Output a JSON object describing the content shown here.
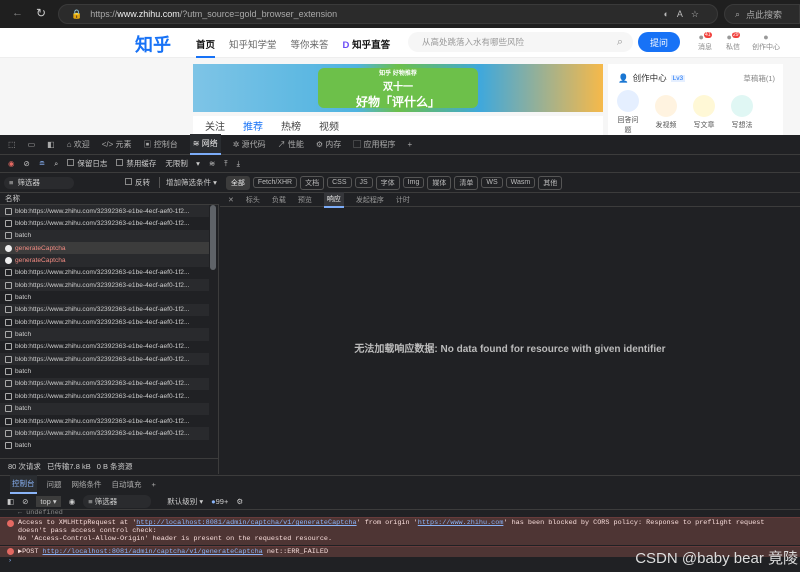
{
  "browser": {
    "url_prefix": "https://",
    "url_host": "www.zhihu.com",
    "url_rest": "/?utm_source=gold_browser_extension",
    "search_placeholder": "点此搜索"
  },
  "zhihu": {
    "logo": "知乎",
    "nav": [
      "首页",
      "知乎知学堂",
      "等你来答",
      "知乎直答"
    ],
    "search_placeholder": "从高处跳落入水有哪些风险",
    "ask": "提问",
    "header_icons": [
      {
        "label": "消息",
        "badge": "41"
      },
      {
        "label": "私信",
        "badge": "29"
      },
      {
        "label": "创作中心"
      }
    ],
    "banner": {
      "brand": "知乎 好物推荐",
      "line1": "双十一",
      "line2": "好物「评什么」"
    },
    "feed_tabs": [
      "关注",
      "推荐",
      "热榜",
      "视频"
    ],
    "creator": {
      "title": "创作中心",
      "level": "Lv3",
      "drafts": "草稿箱(1)",
      "actions": [
        "回答问题",
        "发视频",
        "写文章",
        "写想法"
      ]
    }
  },
  "devtools": {
    "main_tabs": [
      "欢迎",
      "元素",
      "控制台",
      "网络",
      "源代码",
      "性能",
      "内存",
      "应用程序"
    ],
    "preserve_log": "保留日志",
    "disable_cache": "禁用缓存",
    "throttle": "无限制",
    "filter_placeholder": "筛选器",
    "invert": "反转",
    "more_filters": "增加筛选条件",
    "type_filters": [
      "全部",
      "Fetch/XHR",
      "文档",
      "CSS",
      "JS",
      "字体",
      "Img",
      "媒体",
      "清单",
      "WS",
      "Wasm",
      "其他"
    ],
    "name_header": "名称",
    "requests": [
      {
        "name": "blob:https://www.zhihu.com/32392363-e1be-4ecf-aef0-1f2...",
        "type": "blob"
      },
      {
        "name": "blob:https://www.zhihu.com/32392363-e1be-4ecf-aef0-1f2...",
        "type": "blob"
      },
      {
        "name": "batch",
        "type": "doc"
      },
      {
        "name": "generateCaptcha",
        "type": "error",
        "selected": true
      },
      {
        "name": "generateCaptcha",
        "type": "error"
      },
      {
        "name": "blob:https://www.zhihu.com/32392363-e1be-4ecf-aef0-1f2...",
        "type": "blob"
      },
      {
        "name": "blob:https://www.zhihu.com/32392363-e1be-4ecf-aef0-1f2...",
        "type": "blob"
      },
      {
        "name": "batch",
        "type": "doc"
      },
      {
        "name": "blob:https://www.zhihu.com/32392363-e1be-4ecf-aef0-1f2...",
        "type": "blob"
      },
      {
        "name": "blob:https://www.zhihu.com/32392363-e1be-4ecf-aef0-1f2...",
        "type": "blob"
      },
      {
        "name": "batch",
        "type": "doc"
      },
      {
        "name": "blob:https://www.zhihu.com/32392363-e1be-4ecf-aef0-1f2...",
        "type": "blob"
      },
      {
        "name": "blob:https://www.zhihu.com/32392363-e1be-4ecf-aef0-1f2...",
        "type": "blob"
      },
      {
        "name": "batch",
        "type": "doc"
      },
      {
        "name": "blob:https://www.zhihu.com/32392363-e1be-4ecf-aef0-1f2...",
        "type": "blob"
      },
      {
        "name": "blob:https://www.zhihu.com/32392363-e1be-4ecf-aef0-1f2...",
        "type": "blob"
      },
      {
        "name": "batch",
        "type": "doc"
      },
      {
        "name": "blob:https://www.zhihu.com/32392363-e1be-4ecf-aef0-1f2...",
        "type": "blob"
      },
      {
        "name": "blob:https://www.zhihu.com/32392363-e1be-4ecf-aef0-1f2...",
        "type": "blob"
      },
      {
        "name": "batch",
        "type": "doc"
      }
    ],
    "detail_tabs": [
      "标头",
      "负载",
      "预览",
      "响应",
      "发起程序",
      "计时"
    ],
    "detail_message": "无法加载响应数据: No data found for resource with given identifier",
    "status": {
      "requests": "80 次请求",
      "transferred": "已传输7.8 kB",
      "resources": "0 B 条资源"
    },
    "drawer_tabs": [
      "控制台",
      "问题",
      "网络条件",
      "自动填充"
    ],
    "console": {
      "context": "top",
      "filter_placeholder": "筛选器",
      "level": "默认级别",
      "issues": "99+",
      "undefined": "← undefined",
      "cors_pre": "Access to XMLHttpRequest at '",
      "cors_url": "http://localhost:8081/admin/captcha/v1/generateCaptcha",
      "cors_mid": "' from origin '",
      "cors_origin": "https://www.zhihu.com",
      "cors_post": "' has been blocked by CORS policy: Response to preflight request doesn't pass access control check:",
      "cors_line2": "No 'Access-Control-Allow-Origin' header is present on the requested resource.",
      "post_pre": "▶POST ",
      "post_url": "http://localhost:8081/admin/captcha/v1/generateCaptcha",
      "post_post": " net::ERR_FAILED",
      "prompt": "›"
    }
  },
  "watermark": "CSDN @baby bear 竟陵"
}
